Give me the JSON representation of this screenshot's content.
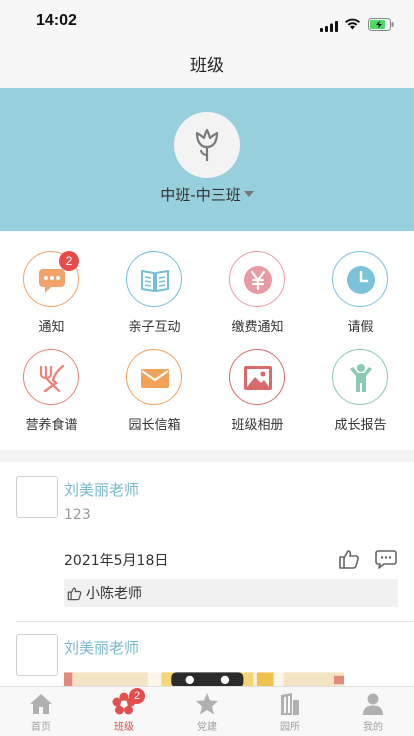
{
  "status_bar": {
    "time": "14:02"
  },
  "nav": {
    "title": "班级"
  },
  "class_header": {
    "name": "中班-中三班"
  },
  "grid": {
    "items": [
      {
        "label": "通知",
        "icon": "message-icon",
        "badge": "2",
        "color": "#f0a36a"
      },
      {
        "label": "亲子互动",
        "icon": "book-icon",
        "color": "#76bfd6"
      },
      {
        "label": "缴费通知",
        "icon": "yen-icon",
        "color": "#e99aa3"
      },
      {
        "label": "请假",
        "icon": "clock-icon",
        "color": "#7cc2db"
      },
      {
        "label": "营养食谱",
        "icon": "fork-knife-icon",
        "color": "#e9847a"
      },
      {
        "label": "园长信箱",
        "icon": "mail-icon",
        "color": "#f2a35a"
      },
      {
        "label": "班级相册",
        "icon": "photo-icon",
        "color": "#d96a6a"
      },
      {
        "label": "成长报告",
        "icon": "child-icon",
        "color": "#8cc8b4"
      }
    ]
  },
  "feed": {
    "posts": [
      {
        "author": "刘美丽老师",
        "content": "123",
        "date": "2021年5月18日",
        "liked_by": "小陈老师"
      },
      {
        "author": "刘美丽老师"
      }
    ]
  },
  "tabbar": {
    "tabs": [
      {
        "label": "首页",
        "icon": "home-icon"
      },
      {
        "label": "班级",
        "icon": "flower-icon",
        "badge": "2",
        "active": true
      },
      {
        "label": "党建",
        "icon": "star-icon"
      },
      {
        "label": "园所",
        "icon": "building-icon"
      },
      {
        "label": "我的",
        "icon": "user-icon"
      }
    ]
  }
}
